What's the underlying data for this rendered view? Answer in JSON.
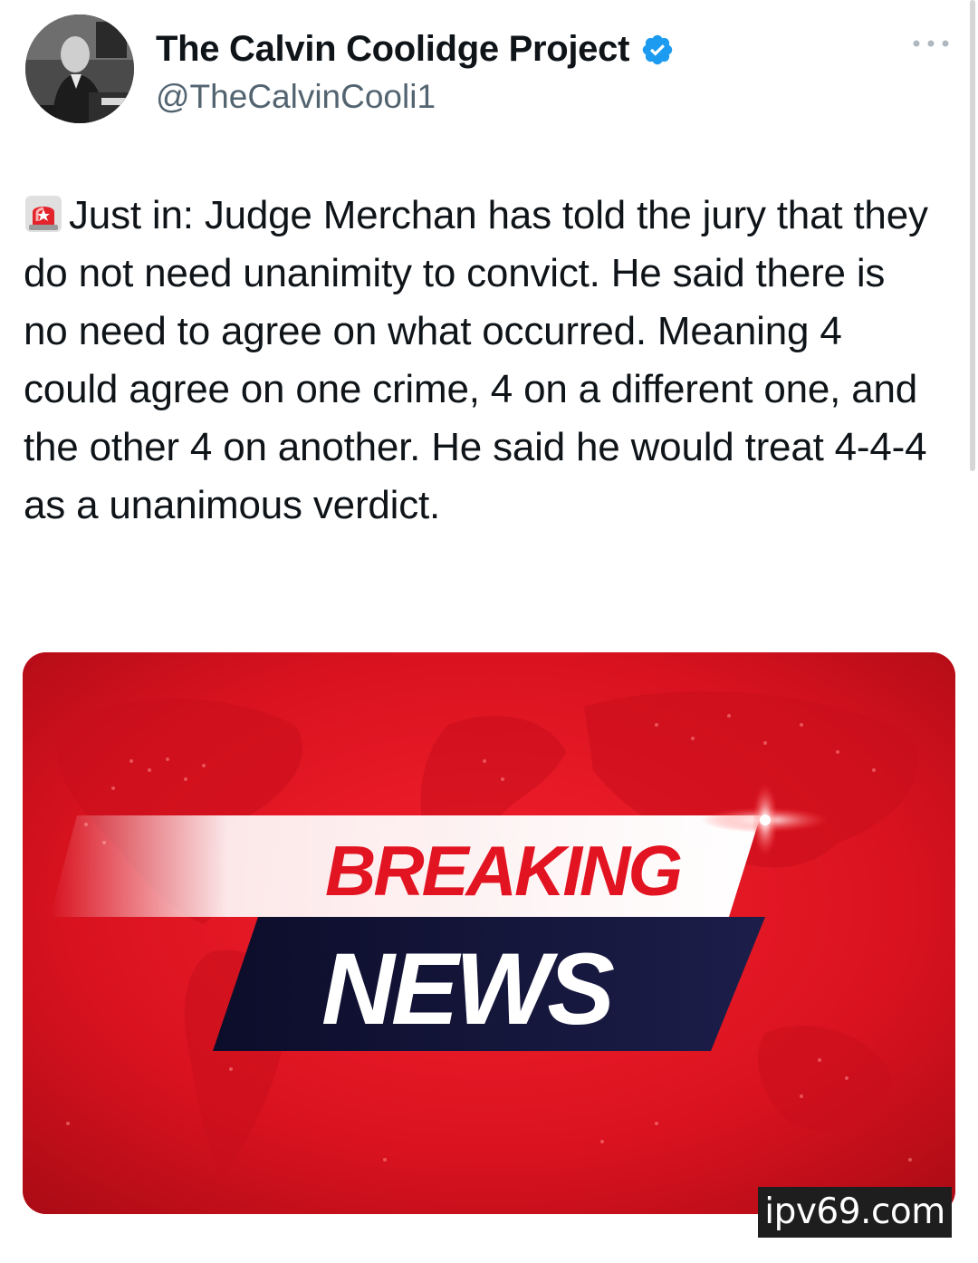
{
  "tweet": {
    "author": {
      "display_name": "The Calvin Coolidge Project",
      "handle": "@TheCalvinCooli1",
      "verified": true
    },
    "text_lead": "Just in: Judge Merchan has told the jury that they do not need unanimity to convict. He said there is no need to agree on what occurred. Meaning 4 could agree on one crime, 4 on a different one, and the other 4 on another. He said he would treat 4-4-4 as a unanimous verdict.",
    "emoji_icon": "siren-icon",
    "media": {
      "headline_top": "BREAKING",
      "headline_bottom": "NEWS"
    }
  },
  "watermark": {
    "text": "ipv69.com"
  },
  "colors": {
    "name": "#0f1419",
    "handle": "#536471",
    "verified": "#1d9bf0",
    "banner_red": "#e31422",
    "banner_navy": "#14163a"
  }
}
